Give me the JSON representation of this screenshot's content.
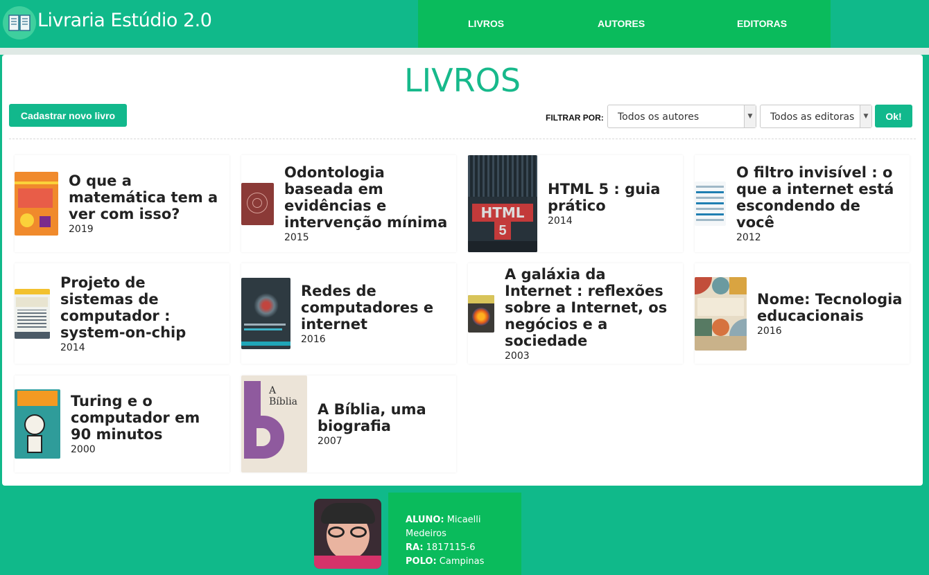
{
  "header": {
    "brand": "Livraria Estúdio 2.0",
    "logo_icon": "open-book-icon",
    "nav": [
      {
        "label": "LIVROS"
      },
      {
        "label": "AUTORES"
      },
      {
        "label": "EDITORAS"
      }
    ]
  },
  "main": {
    "title": "LIVROS",
    "new_button": "Cadastrar novo livro",
    "filter_label": "FILTRAR POR:",
    "author_select": "Todos os autores",
    "publisher_select": "Todos as editoras",
    "ok_button": "Ok!"
  },
  "books": [
    {
      "title": "O que a matemática tem a ver com isso?",
      "year": "2019"
    },
    {
      "title": "Odontologia baseada em evidências e intervenção mínima",
      "year": "2015"
    },
    {
      "title": "HTML 5 : guia prático",
      "year": "2014"
    },
    {
      "title": "O filtro invisível : o que a internet está escondendo de você",
      "year": "2012"
    },
    {
      "title": "Projeto de sistemas de computador : system-on-chip",
      "year": "2014"
    },
    {
      "title": "Redes de computadores e internet",
      "year": "2016"
    },
    {
      "title": "A galáxia da Internet : reflexões sobre a Internet, os negócios e a sociedade",
      "year": "2003"
    },
    {
      "title": "Nome: Tecnologia educacionais",
      "year": "2016"
    },
    {
      "title": "Turing e o computador em 90 minutos",
      "year": "2000"
    },
    {
      "title": "A Bíblia, uma biografia",
      "year": "2007"
    }
  ],
  "footer": {
    "aluno_label": "ALUNO:",
    "aluno_value": "Micaelli Medeiros",
    "ra_label": "RA:",
    "ra_value": "1817115-6",
    "polo_label": "POLO:",
    "polo_value": "Campinas"
  },
  "colors": {
    "brand_green": "#10b98a",
    "nav_green": "#0abb5c",
    "accent": "#17b98b"
  }
}
